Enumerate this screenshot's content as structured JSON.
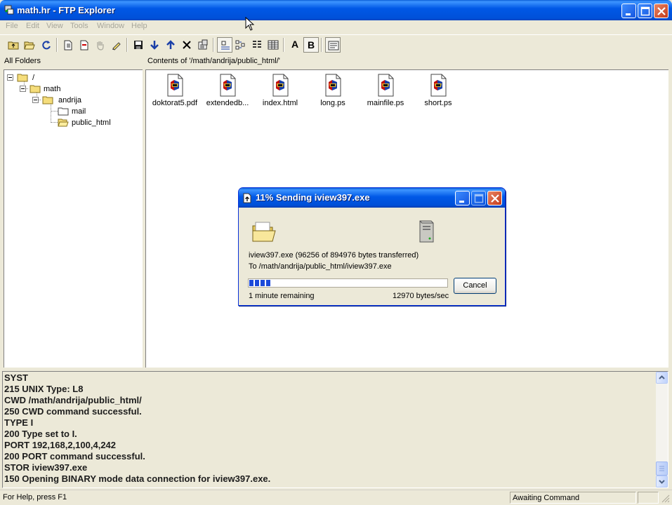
{
  "window": {
    "title": "math.hr - FTP Explorer"
  },
  "menu": [
    "File",
    "Edit",
    "View",
    "Tools",
    "Window",
    "Help"
  ],
  "toolbar": {
    "text_label": "A",
    "bold_label": "B"
  },
  "folders_header": "All Folders",
  "contents_header": "Contents of '/math/andrija/public_html/'",
  "tree": [
    {
      "label": "/"
    },
    {
      "label": "math"
    },
    {
      "label": "andrija"
    },
    {
      "label": "mail"
    },
    {
      "label": "public_html"
    }
  ],
  "files": [
    {
      "name": "doktorat5.pdf",
      "icon": "winamp-file-icon"
    },
    {
      "name": "extendedb...",
      "icon": "winamp-file-icon"
    },
    {
      "name": "index.html",
      "icon": "winamp-file-icon"
    },
    {
      "name": "long.ps",
      "icon": "winamp-file-icon"
    },
    {
      "name": "mainfile.ps",
      "icon": "winamp-file-icon"
    },
    {
      "name": "short.ps",
      "icon": "winamp-file-icon"
    }
  ],
  "log": [
    "SYST",
    "215 UNIX Type: L8",
    "CWD /math/andrija/public_html/",
    "250 CWD command successful.",
    "TYPE I",
    "200 Type set to I.",
    "PORT 192,168,2,100,4,242",
    "200 PORT command successful.",
    "STOR iview397.exe",
    "150 Opening BINARY mode data connection for iview397.exe."
  ],
  "status": {
    "help": "For Help, press F1",
    "state": "Awaiting Command"
  },
  "dialog": {
    "title": "11% Sending iview397.exe",
    "file_line": "iview397.exe (96256 of 894976 bytes transferred)",
    "dest_line": "To /math/andrija/public_html/iview397.exe",
    "remaining": "1 minute remaining",
    "rate": "12970 bytes/sec",
    "cancel_label": "Cancel",
    "progress": 0.11
  }
}
